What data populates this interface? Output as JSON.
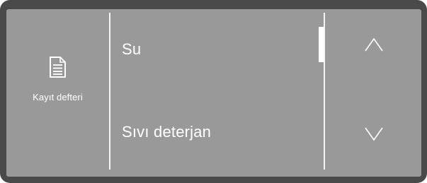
{
  "logbook": {
    "icon": "document-icon",
    "label": "Kayıt defteri"
  },
  "menu": {
    "items": [
      {
        "label": "Su"
      },
      {
        "label": "Sıvı deterjan"
      }
    ]
  },
  "navigation": {
    "up_icon": "chevron-up-icon",
    "down_icon": "chevron-down-icon"
  },
  "scroll": {
    "position_fraction": 0.0
  },
  "colors": {
    "bezel": "#4a4a4a",
    "screen": "#999999",
    "foreground": "#ffffff"
  }
}
